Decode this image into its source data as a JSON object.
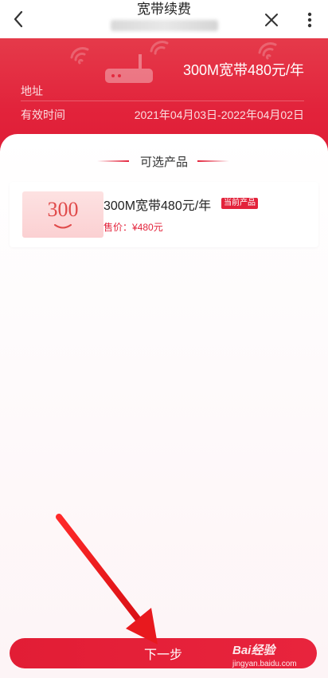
{
  "nav": {
    "title": "宽带续费",
    "back_icon": "chevron-left-icon",
    "close_icon": "close-icon",
    "more_icon": "more-vertical-icon"
  },
  "header": {
    "product_title": "300M宽带480元/年",
    "address_label": "地址",
    "validity_label": "有效时间",
    "validity_value": "2021年04月03日-2022年04月02日"
  },
  "section": {
    "title": "可选产品"
  },
  "products": [
    {
      "thumb_number": "300",
      "name": "300M宽带480元/年",
      "badge": "当前产品",
      "price": "售价：¥480元"
    }
  ],
  "footer": {
    "next_label": "下一步"
  },
  "watermark": {
    "logo": "Bai经验",
    "site": "jingyan.baidu.com"
  },
  "colors": {
    "brand_red": "#e3233b",
    "annotation_red": "#e8191e"
  }
}
